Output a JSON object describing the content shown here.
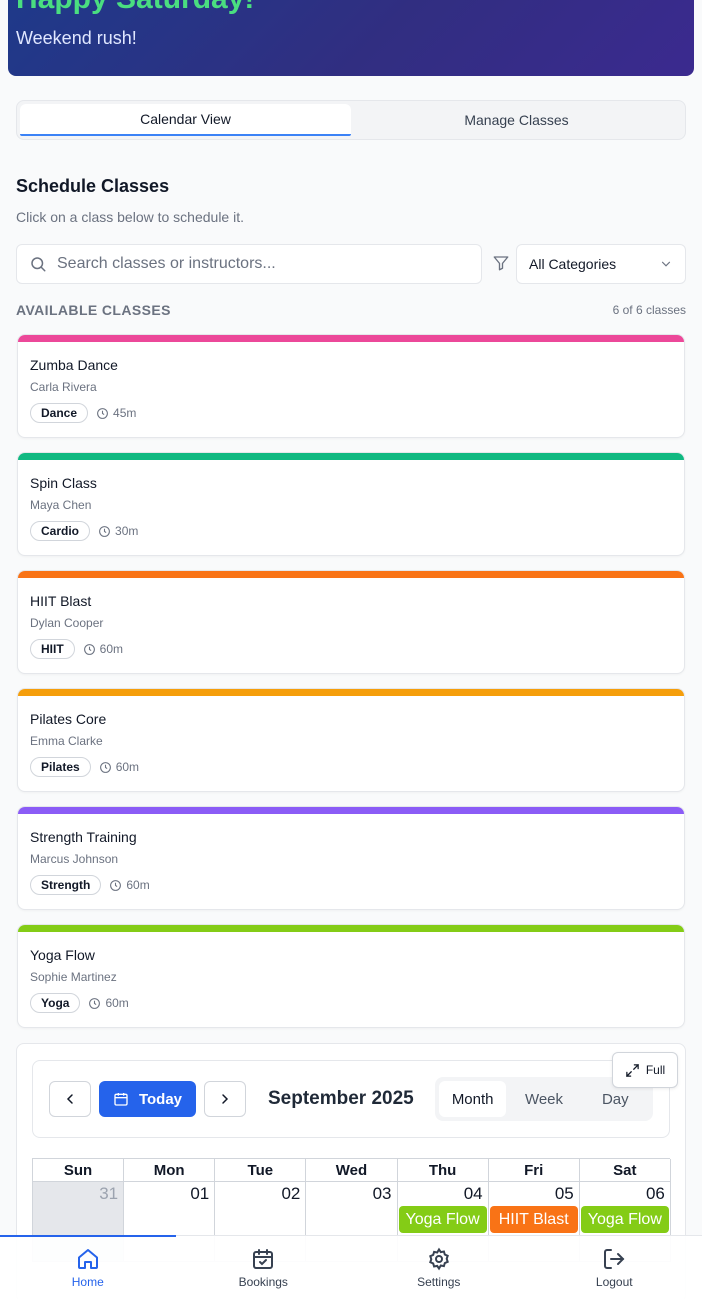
{
  "hero": {
    "title": "Happy Saturday!",
    "subtitle": "Weekend rush!"
  },
  "tabs": [
    {
      "label": "Calendar View",
      "active": true
    },
    {
      "label": "Manage Classes",
      "active": false
    }
  ],
  "schedule": {
    "title": "Schedule Classes",
    "description": "Click on a class below to schedule it."
  },
  "search": {
    "placeholder": "Search classes or instructors...",
    "value": ""
  },
  "category_filter": {
    "selected": "All Categories"
  },
  "available": {
    "label": "AVAILABLE CLASSES",
    "count": "6 of 6 classes"
  },
  "classes": [
    {
      "name": "Zumba Dance",
      "instructor": "Carla Rivera",
      "category": "Dance",
      "duration": "45m",
      "color": "#ec4899"
    },
    {
      "name": "Spin Class",
      "instructor": "Maya Chen",
      "category": "Cardio",
      "duration": "30m",
      "color": "#10b981"
    },
    {
      "name": "HIIT Blast",
      "instructor": "Dylan Cooper",
      "category": "HIIT",
      "duration": "60m",
      "color": "#f97316"
    },
    {
      "name": "Pilates Core",
      "instructor": "Emma Clarke",
      "category": "Pilates",
      "duration": "60m",
      "color": "#f59e0b"
    },
    {
      "name": "Strength Training",
      "instructor": "Marcus Johnson",
      "category": "Strength",
      "duration": "60m",
      "color": "#8b5cf6"
    },
    {
      "name": "Yoga Flow",
      "instructor": "Sophie Martinez",
      "category": "Yoga",
      "duration": "60m",
      "color": "#84cc16"
    }
  ],
  "calendar": {
    "today_label": "Today",
    "month_label": "September 2025",
    "views": [
      {
        "label": "Month",
        "active": true
      },
      {
        "label": "Week",
        "active": false
      },
      {
        "label": "Day",
        "active": false
      }
    ],
    "full_label": "Full",
    "weekdays": [
      "Sun",
      "Mon",
      "Tue",
      "Wed",
      "Thu",
      "Fri",
      "Sat"
    ],
    "days": [
      {
        "num": "31",
        "other_month": true,
        "event": null
      },
      {
        "num": "01",
        "other_month": false,
        "event": null
      },
      {
        "num": "02",
        "other_month": false,
        "event": null
      },
      {
        "num": "03",
        "other_month": false,
        "event": null
      },
      {
        "num": "04",
        "other_month": false,
        "event": {
          "title": "Yoga Flow",
          "color": "#84cc16"
        }
      },
      {
        "num": "05",
        "other_month": false,
        "event": {
          "title": "HIIT Blast",
          "color": "#f97316"
        }
      },
      {
        "num": "06",
        "other_month": false,
        "event": {
          "title": "Yoga Flow",
          "color": "#84cc16"
        }
      }
    ]
  },
  "bottom_nav": [
    {
      "label": "Home",
      "icon": "home-icon",
      "active": true
    },
    {
      "label": "Bookings",
      "icon": "calendar-check-icon",
      "active": false
    },
    {
      "label": "Settings",
      "icon": "gear-icon",
      "active": false
    },
    {
      "label": "Logout",
      "icon": "logout-icon",
      "active": false
    }
  ]
}
